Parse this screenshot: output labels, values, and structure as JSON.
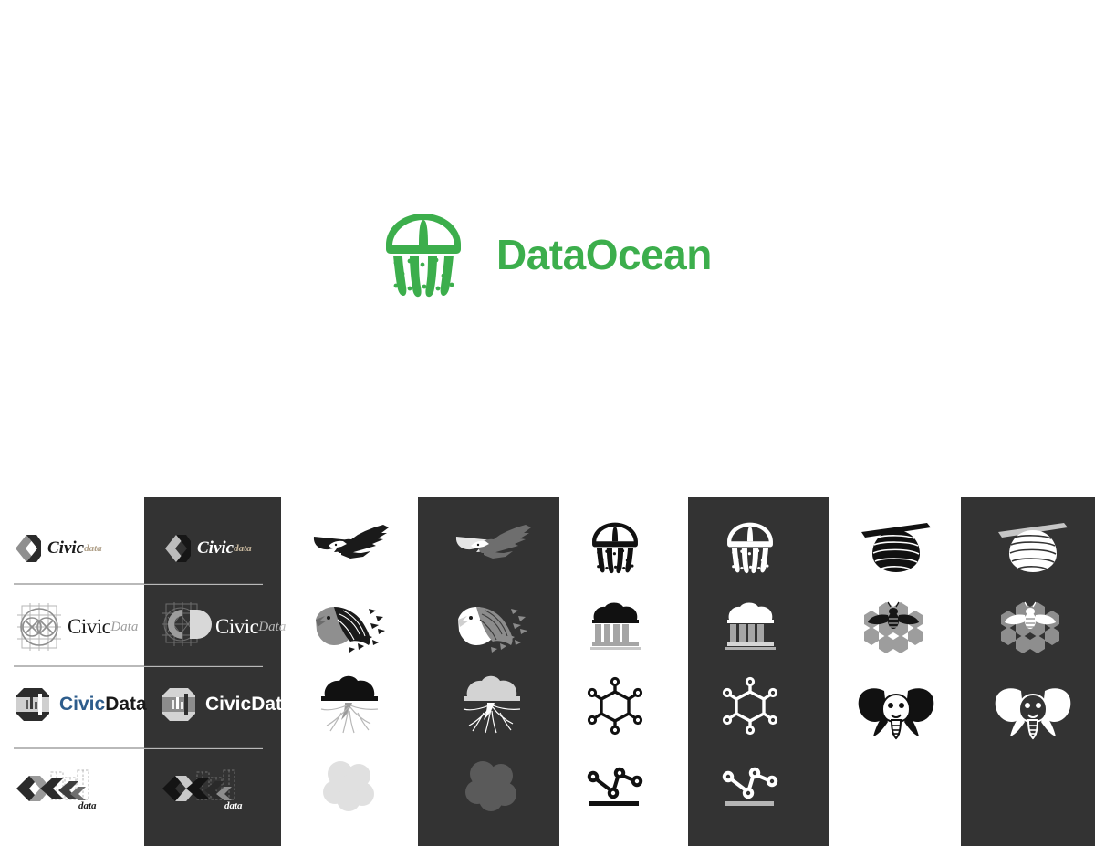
{
  "hero": {
    "brand_name": "DataOcean",
    "mark": "jellyfish-icon",
    "brand_color": "#3cae4c"
  },
  "theme": {
    "background": "#ffffff",
    "panel_dark": "#333333",
    "divider": "#b9b9b9",
    "ink": "#1a1a1a",
    "mid_gray": "#9a9a9a",
    "light_gray": "#cccccc",
    "blue": "#2e5d8c",
    "tan": "#b5a48a"
  },
  "grid": {
    "columns": [
      {
        "id": "column-wordmarks-light",
        "variant": "light",
        "cells": [
          {
            "id": "civicdata-chevron",
            "icon": "chevron-cube-icon",
            "word_primary": "Civic",
            "word_secondary": "data"
          },
          {
            "id": "civicdata-compass",
            "icon": "compass-grid-icon",
            "word_primary": "Civic",
            "word_secondary": "Data"
          },
          {
            "id": "civicdata-octagon",
            "icon": "octagon-chart-icon",
            "word_primary": "Civic",
            "word_secondary": "Data"
          },
          {
            "id": "civicdata-arrows",
            "icon": "arrow-blocks-city-icon",
            "word_primary": "",
            "word_secondary": "data"
          }
        ]
      },
      {
        "id": "column-wordmarks-dark",
        "variant": "dark",
        "cells": [
          {
            "id": "civicdata-chevron-dark",
            "icon": "chevron-cube-icon",
            "word_primary": "Civic",
            "word_secondary": "data"
          },
          {
            "id": "civicdata-cd-dark",
            "icon": "cd-monogram-icon",
            "word_primary": "Civic",
            "word_secondary": "Data"
          },
          {
            "id": "civicdata-octagon-dark",
            "icon": "octagon-chart-icon",
            "word_primary": "Civic",
            "word_secondary": "Data"
          },
          {
            "id": "civicdata-arrows-dark",
            "icon": "arrow-blocks-city-icon",
            "word_primary": "",
            "word_secondary": "data"
          }
        ]
      },
      {
        "id": "column-marks-a-light",
        "variant": "light",
        "cells": [
          {
            "id": "eagle-soaring",
            "icon": "eagle-soaring-icon"
          },
          {
            "id": "eagle-head",
            "icon": "eagle-head-icon"
          },
          {
            "id": "cloud-roots",
            "icon": "cloud-roots-icon"
          },
          {
            "id": "bubbles",
            "icon": "overlapping-bubbles-icon"
          }
        ]
      },
      {
        "id": "column-marks-a-dark",
        "variant": "dark",
        "cells": [
          {
            "id": "eagle-soaring-dark",
            "icon": "eagle-soaring-icon"
          },
          {
            "id": "eagle-head-dark",
            "icon": "eagle-head-icon"
          },
          {
            "id": "cloud-roots-dark",
            "icon": "cloud-roots-icon"
          },
          {
            "id": "bubbles-dark",
            "icon": "overlapping-bubbles-icon"
          }
        ]
      },
      {
        "id": "column-marks-b-light",
        "variant": "light",
        "cells": [
          {
            "id": "jellyfish",
            "icon": "jellyfish-icon"
          },
          {
            "id": "cloud-bank",
            "icon": "cloud-bank-icon"
          },
          {
            "id": "hex-nodes",
            "icon": "hex-node-network-icon"
          },
          {
            "id": "line-nodes",
            "icon": "node-line-chart-icon"
          }
        ]
      },
      {
        "id": "column-marks-b-dark",
        "variant": "dark",
        "cells": [
          {
            "id": "jellyfish-dark",
            "icon": "jellyfish-icon"
          },
          {
            "id": "cloud-bank-dark",
            "icon": "cloud-bank-icon"
          },
          {
            "id": "hex-nodes-dark",
            "icon": "hex-node-network-icon"
          },
          {
            "id": "line-nodes-dark",
            "icon": "node-line-chart-icon"
          }
        ]
      },
      {
        "id": "column-marks-c-light",
        "variant": "light",
        "cells": [
          {
            "id": "beehive",
            "icon": "beehive-icon"
          },
          {
            "id": "bee-honeycomb",
            "icon": "bee-honeycomb-icon"
          },
          {
            "id": "elephant",
            "icon": "elephant-head-icon"
          }
        ]
      },
      {
        "id": "column-marks-c-dark",
        "variant": "dark",
        "cells": [
          {
            "id": "beehive-dark",
            "icon": "beehive-icon"
          },
          {
            "id": "bee-honeycomb-dark",
            "icon": "bee-honeycomb-icon"
          },
          {
            "id": "elephant-dark",
            "icon": "elephant-head-icon"
          }
        ]
      }
    ]
  }
}
